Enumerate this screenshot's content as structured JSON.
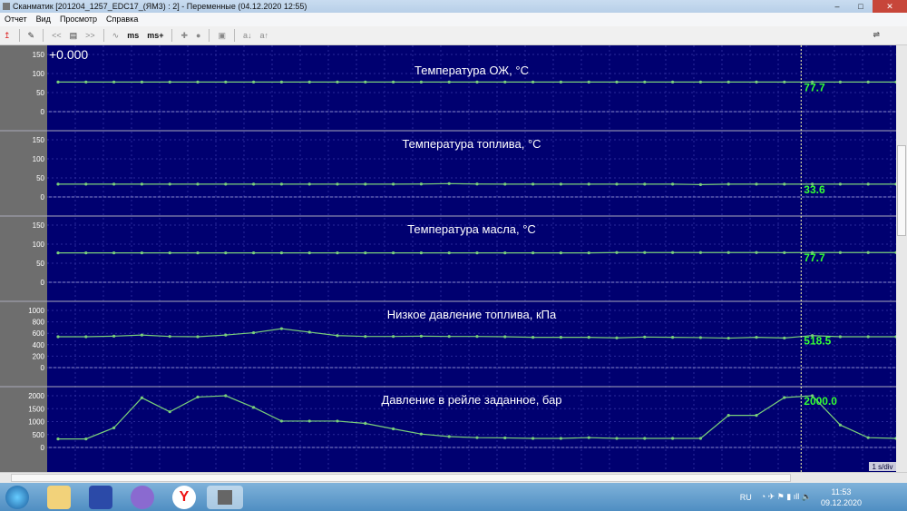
{
  "window": {
    "title": "Сканматик [201204_1257_EDC17_(ЯМ3) : 2] - Переменные (04.12.2020  12:55)",
    "minimize": "–",
    "maximize": "□",
    "close": "✕"
  },
  "menu": [
    "Отчет",
    "Вид",
    "Просмотр",
    "Справка"
  ],
  "toolbar": [
    "↥",
    "✎",
    "<<",
    "▤",
    ">>",
    "∿",
    "ms",
    "ms+",
    "✚",
    "●",
    "▣",
    "a↓",
    "a↑"
  ],
  "toolbar_usb": "⇌",
  "offset_label": "+0.000",
  "time_scale": "1 s/div",
  "cursor_index": 26.6,
  "colors": {
    "plot_bg": "#000070",
    "line": "#7ad07a",
    "value": "#33ff33",
    "axis_bg": "#6e6e6e"
  },
  "chart_data": [
    {
      "type": "line",
      "title": "Температура ОЖ, °С",
      "ylim": [
        0,
        150
      ],
      "ticks": [
        150,
        100,
        50,
        0
      ],
      "cursor_value": "77.7",
      "values": [
        77.7,
        77.7,
        77.7,
        77.7,
        77.7,
        77.7,
        77.7,
        77.7,
        77.7,
        77.7,
        77.7,
        77.7,
        77.7,
        77.7,
        77.7,
        77.7,
        77.7,
        77.7,
        77.7,
        77.7,
        77.7,
        77.7,
        77.7,
        77.7,
        77.7,
        77.7,
        77.7,
        77.7,
        77.7,
        77.7,
        77.7
      ]
    },
    {
      "type": "line",
      "title": "Температура топлива, °С",
      "ylim": [
        0,
        150
      ],
      "ticks": [
        150,
        100,
        50,
        0
      ],
      "cursor_value": "33.6",
      "values": [
        33.6,
        33.6,
        33.6,
        33.6,
        33.6,
        33.6,
        33.6,
        33.6,
        33.6,
        33.6,
        33.6,
        33.6,
        33.6,
        34,
        35,
        34,
        33.6,
        33.6,
        33.6,
        33.6,
        33.6,
        33.6,
        33.6,
        32.5,
        33.6,
        33.6,
        33.6,
        33.6,
        33.6,
        33.6,
        33.6
      ]
    },
    {
      "type": "line",
      "title": "Температура масла, °С",
      "ylim": [
        0,
        150
      ],
      "ticks": [
        150,
        100,
        50,
        0
      ],
      "cursor_value": "77.7",
      "values": [
        77,
        77,
        77,
        77,
        77,
        77,
        77,
        77,
        77,
        77,
        77,
        77,
        77,
        77,
        77,
        77,
        77,
        77,
        77,
        77,
        78,
        78,
        78,
        78,
        78,
        78,
        77.7,
        78,
        78,
        78,
        78
      ]
    },
    {
      "type": "line",
      "title": "Низкое давление топлива, кПа",
      "ylim": [
        0,
        1000
      ],
      "ticks": [
        1000,
        800,
        600,
        400,
        200,
        0
      ],
      "cursor_value": "518.5",
      "values": [
        540,
        540,
        550,
        570,
        545,
        540,
        570,
        610,
        680,
        620,
        560,
        545,
        545,
        550,
        545,
        545,
        540,
        530,
        530,
        530,
        520,
        535,
        530,
        525,
        515,
        530,
        518,
        560,
        540,
        540,
        540
      ]
    },
    {
      "type": "line",
      "title": "Давление в рейле заданное, бар",
      "ylim": [
        0,
        2000
      ],
      "ticks": [
        2000,
        1500,
        1000,
        500,
        0
      ],
      "cursor_value": "2000.0",
      "values": [
        330,
        330,
        760,
        1920,
        1380,
        1950,
        2000,
        1550,
        1020,
        1020,
        1020,
        930,
        720,
        520,
        420,
        380,
        370,
        350,
        350,
        380,
        350,
        350,
        350,
        350,
        1240,
        1240,
        1930,
        2000,
        870,
        380,
        350
      ]
    }
  ],
  "tray": {
    "lang": "RU",
    "time": "11:53",
    "date": "09.12.2020"
  }
}
